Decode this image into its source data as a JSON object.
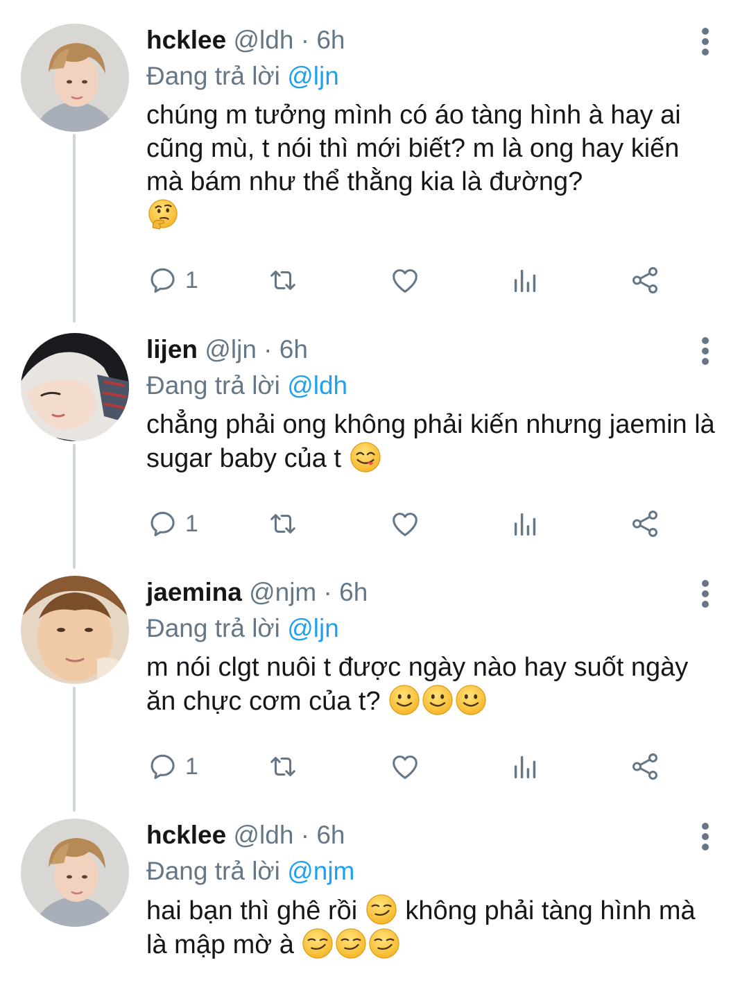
{
  "tweets": [
    {
      "name": "hcklee",
      "handle": "@ldh",
      "separator": "·",
      "time": "6h",
      "replying_prefix": "Đang trả lời",
      "replying_to": "@ljn",
      "text": "chúng m tưởng mình có áo tàng hình à hay ai cũng mù, t nói thì mới biết? m là ong hay kiến mà bám như thể thằng kia là đường?",
      "emojis": [
        "thinking-face"
      ],
      "reply_count": "1"
    },
    {
      "name": "lijen",
      "handle": "@ljn",
      "separator": "·",
      "time": "6h",
      "replying_prefix": "Đang trả lời",
      "replying_to": "@ldh",
      "text": "chẳng phải ong không phải kiến nhưng jaemin là sugar baby của t",
      "emojis": [
        "yum-face"
      ],
      "reply_count": "1"
    },
    {
      "name": "jaemina",
      "handle": "@njm",
      "separator": "·",
      "time": "6h",
      "replying_prefix": "Đang trả lời",
      "replying_to": "@ljn",
      "text": "m nói clgt nuôi t được ngày nào hay suốt ngày ăn chực cơm của t?",
      "emojis": [
        "slight-smile",
        "slight-smile",
        "slight-smile"
      ],
      "reply_count": "1"
    },
    {
      "name": "hcklee",
      "handle": "@ldh",
      "separator": "·",
      "time": "6h",
      "replying_prefix": "Đang trả lời",
      "replying_to": "@njm",
      "text_part1": "hai bạn thì ghê rồi",
      "text_part2": "không phải tàng hình mà là mập mờ à",
      "emojis": [
        "smirk-face",
        "smirk-face",
        "smirk-face",
        "smirk-face"
      ]
    }
  ],
  "icons": {
    "reply": "reply-icon",
    "retweet": "retweet-icon",
    "like": "heart-icon",
    "analytics": "analytics-icon",
    "share": "share-icon",
    "more": "more-vertical-icon"
  },
  "colors": {
    "name": "#14171a",
    "meta": "#657786",
    "mention": "#1da1f2",
    "thread_line": "#ccd6dd"
  }
}
